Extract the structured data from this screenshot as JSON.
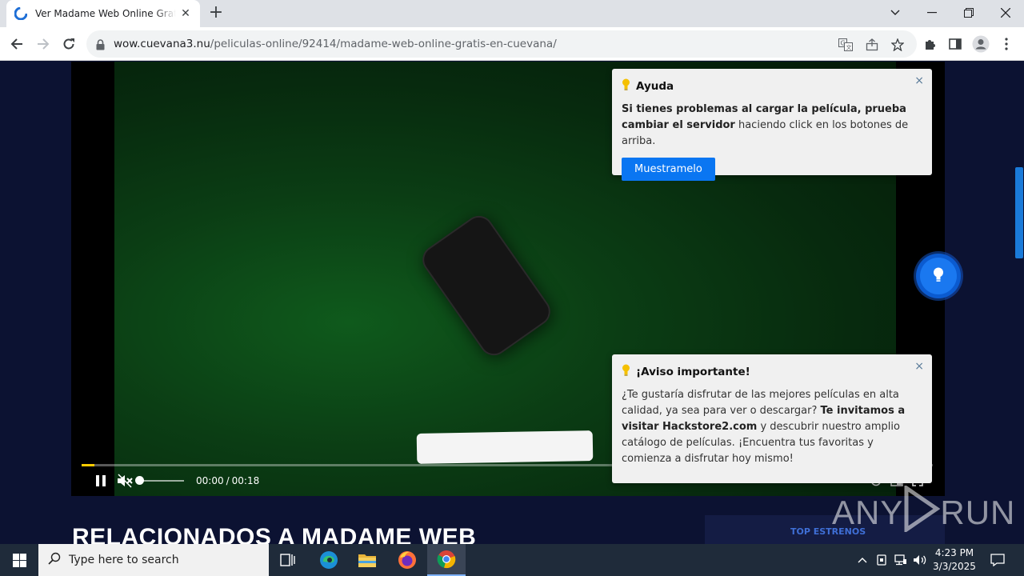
{
  "browser": {
    "tab_title": "Ver Madame Web Online Gratis en Cuevana",
    "url_host": "wow.cuevana3.nu",
    "url_path": "/peliculas-online/92414/madame-web-online-gratis-en-cuevana/"
  },
  "player": {
    "current_time": "00:00",
    "duration": "00:18",
    "time_separator": "/",
    "progress_fraction": 0.015,
    "volume_fraction": 0.0,
    "muted": true,
    "playing": true
  },
  "help_popup": {
    "title": "Ayuda",
    "body_bold": "Si tienes problemas al cargar la película, prueba cambiar el servidor",
    "body_rest": " haciendo click en los botones de arriba.",
    "button_label": "Muestramelo",
    "close_label": "×"
  },
  "notice_popup": {
    "title": "¡Aviso importante!",
    "body_part1": "¿Te gustaría disfrutar de las mejores películas en alta calidad, ya sea para ver o descargar? ",
    "body_bold": "Te invitamos a visitar Hackstore2.com",
    "body_part2": " y descubrir nuestro amplio catálogo de películas. ¡Encuentra tus favoritas y comienza a disfrutar hoy mismo!",
    "close_label": "×"
  },
  "page": {
    "section_title": "RELACIONADOS A MADAME WEB",
    "side_tab_label": "TOP ESTRENOS"
  },
  "watermark": {
    "text_left": "ANY",
    "text_right": "RUN"
  },
  "taskbar": {
    "search_placeholder": "Type here to search",
    "time": "4:23 PM",
    "date": "3/3/2025"
  },
  "colors": {
    "accent": "#0a76f2",
    "progress": "#ffcc00",
    "page_bg": "#0c1232"
  }
}
